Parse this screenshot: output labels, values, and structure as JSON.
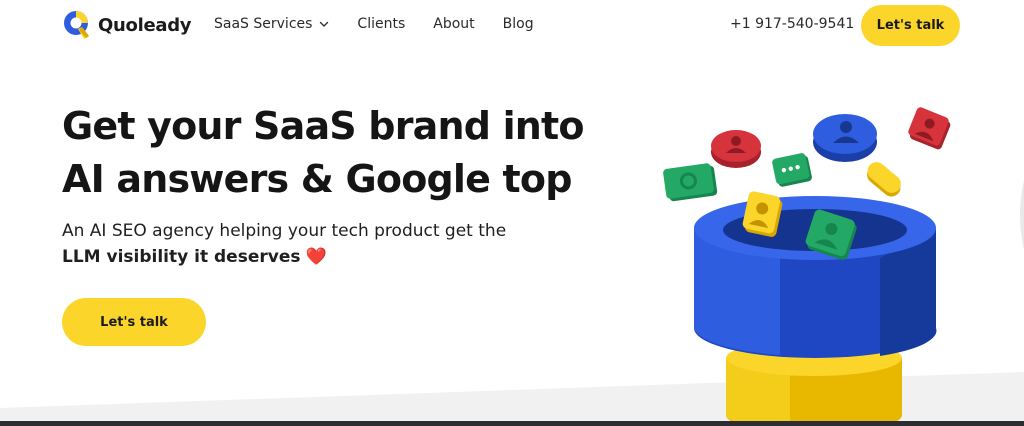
{
  "header": {
    "logo_text": "Quoleady",
    "nav": [
      {
        "label": "SaaS Services",
        "has_dropdown": true
      },
      {
        "label": "Clients"
      },
      {
        "label": "About"
      },
      {
        "label": "Blog"
      }
    ],
    "phone": "+1 917-540-9541",
    "cta_label": "Let's talk"
  },
  "hero": {
    "title_line1": "Get your SaaS brand into",
    "title_line2": "AI answers & Google top",
    "subtitle_line1": "An AI SEO agency helping your tech product get the",
    "subtitle_strong": "LLM visibility it deserves",
    "subtitle_emoji": "❤️",
    "cta_label": "Let's talk"
  },
  "colors": {
    "accent_yellow": "#fcd52b",
    "funnel_blue": "#2f5de0",
    "card_red": "#d6333c",
    "card_green": "#24a866",
    "text_dark": "#151515"
  },
  "icons": [
    "logo-q-icon",
    "chevron-down-icon",
    "heart-emoji",
    "funnel-illustration",
    "person-card-icon",
    "chat-bubble-icon",
    "phone-card-icon"
  ]
}
